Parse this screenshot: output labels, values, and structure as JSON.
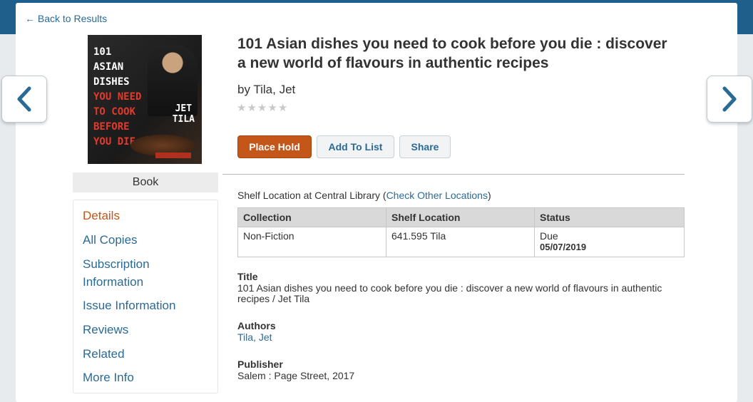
{
  "back_link": "← Back to Results",
  "nav": {
    "prev_icon": "chevron-left-icon",
    "next_icon": "chevron-right-icon"
  },
  "cover": {
    "title_white": [
      "101",
      "ASIAN",
      "DISHES"
    ],
    "title_red": [
      "YOU NEED",
      "TO COOK",
      "BEFORE",
      "YOU DIE"
    ],
    "author_lines": [
      "JET",
      "TILA"
    ]
  },
  "format": "Book",
  "sidebar": {
    "items": [
      {
        "label": "Details",
        "active": true
      },
      {
        "label": "All Copies"
      },
      {
        "label": "Subscription Information"
      },
      {
        "label": "Issue Information"
      },
      {
        "label": "Reviews"
      },
      {
        "label": "Related"
      },
      {
        "label": "More Info"
      }
    ]
  },
  "book": {
    "title": "101 Asian dishes you need to cook before you die : discover a new world of flavours in authentic recipes",
    "by": "by Tila, Jet",
    "rating": 0
  },
  "buttons": {
    "place_hold": "Place Hold",
    "add_to_list": "Add To List",
    "share": "Share"
  },
  "shelf": {
    "prefix": "Shelf Location at Central Library (",
    "link": "Check Other Locations",
    "suffix": ")"
  },
  "copies": {
    "headers": [
      "Collection",
      "Shelf Location",
      "Status"
    ],
    "rows": [
      {
        "collection": "Non-Fiction",
        "shelf_location": "641.595 Tila",
        "status": "Due",
        "due_date": "05/07/2019"
      }
    ]
  },
  "fields": {
    "title_label": "Title",
    "title_value": "101 Asian dishes you need to cook before you die : discover a new world of flavours in authentic recipes / Jet Tila",
    "authors_label": "Authors",
    "authors_value": "Tila, Jet",
    "publisher_label": "Publisher",
    "publisher_value": "Salem : Page Street, 2017"
  },
  "colors": {
    "accent": "#c4561a",
    "link": "#2a6b95",
    "header": "#1f5f8b"
  }
}
